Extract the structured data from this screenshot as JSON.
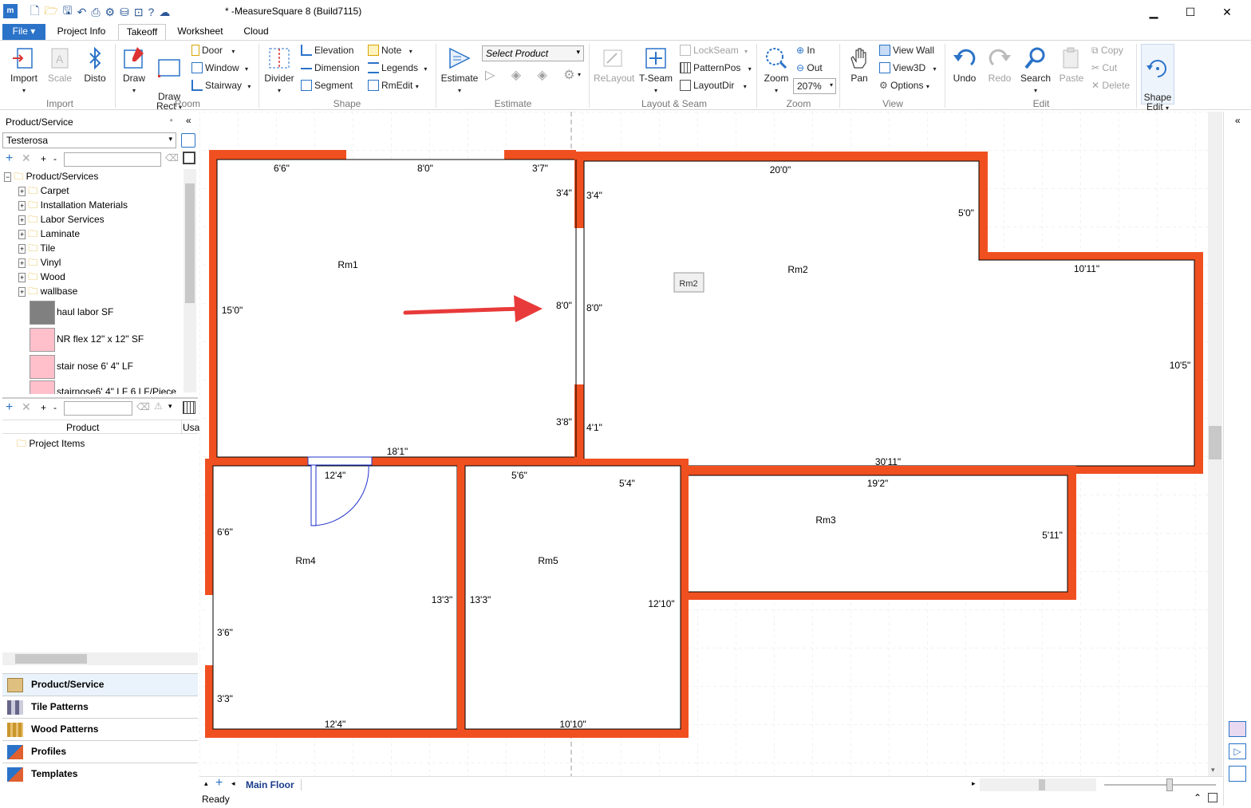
{
  "window": {
    "title": "* -MeasureSquare 8 (Build7115)",
    "minimize": "▁",
    "maximize": "☐",
    "close": "✕"
  },
  "tabs": [
    "File ▾",
    "Project Info",
    "Takeoff",
    "Worksheet",
    "Cloud"
  ],
  "ribbon": {
    "import": "Import",
    "scale": "Scale",
    "disto": "Disto",
    "draw": "Draw",
    "draw_rect": "Draw\nRect",
    "door": "Door",
    "window": "Window",
    "stairway": "Stairway",
    "divider": "Divider",
    "elevation": "Elevation",
    "dimension": "Dimension",
    "segment": "Segment",
    "note": "Note",
    "legends": "Legends",
    "rmedit": "RmEdit",
    "estimate": "Estimate",
    "select_product": "Select Product",
    "relayout": "ReLayout",
    "tseam": "T-Seam",
    "lockseam": "LockSeam",
    "patternpos": "PatternPos",
    "layoutdir": "LayoutDir",
    "zoom": "Zoom",
    "zoom_in": "In",
    "zoom_out": "Out",
    "zoom_level": "207%",
    "pan": "Pan",
    "view_wall": "View Wall",
    "view3d": "View3D",
    "options": "Options",
    "undo": "Undo",
    "redo": "Redo",
    "search": "Search",
    "paste": "Paste",
    "copy": "Copy",
    "cut": "Cut",
    "delete": "Delete",
    "shape_edit": "Shape\nEdit",
    "groups": [
      "Import",
      "Room",
      "Shape",
      "Estimate",
      "Layout & Seam",
      "Zoom",
      "View",
      "Edit"
    ]
  },
  "left_panel": {
    "title": "Product/Service",
    "dropdown": "Testerosa",
    "tree_root": "Product/Services",
    "categories": [
      "Carpet",
      "Installation Materials",
      "Labor Services",
      "Laminate",
      "Tile",
      "Vinyl",
      "Wood",
      "wallbase"
    ],
    "products": [
      {
        "name": "haul labor  SF",
        "color": "#808080"
      },
      {
        "name": "NR flex 12\" x 12\" SF",
        "color": "#ffc0cb"
      },
      {
        "name": "stair nose 6' 4\" LF",
        "color": "#ffc0cb"
      },
      {
        "name": "stairnose6' 4\" LF 6 LF/Piece",
        "color": "#ffc0cb"
      }
    ],
    "grid_header_product": "Product",
    "grid_header_usage": "Usa",
    "project_items": "Project Items",
    "nav": [
      "Product/Service",
      "Tile Patterns",
      "Wood Patterns",
      "Profiles",
      "Templates"
    ]
  },
  "canvas": {
    "rooms": [
      "Rm1",
      "Rm2",
      "Rm3",
      "Rm4",
      "Rm5"
    ],
    "rm2_tag": "Rm2",
    "dims": [
      "6'6\"",
      "8'0\"",
      "3'7\"",
      "3'4\"",
      "3'4\"",
      "20'0\"",
      "5'0\"",
      "10'11\"",
      "15'0\"",
      "8'0\"",
      "8'0\"",
      "10'5\"",
      "3'8\"",
      "4'1\"",
      "18'1\"",
      "30'11\"",
      "12'4\"",
      "5'6\"",
      "5'4\"",
      "19'2\"",
      "6'6\"",
      "5'11\"",
      "13'3\"",
      "13'3\"",
      "12'10\"",
      "3'6\"",
      "3'3\"",
      "12'4\"",
      "10'10\""
    ]
  },
  "floor_tab": "Main Floor",
  "status": "Ready"
}
